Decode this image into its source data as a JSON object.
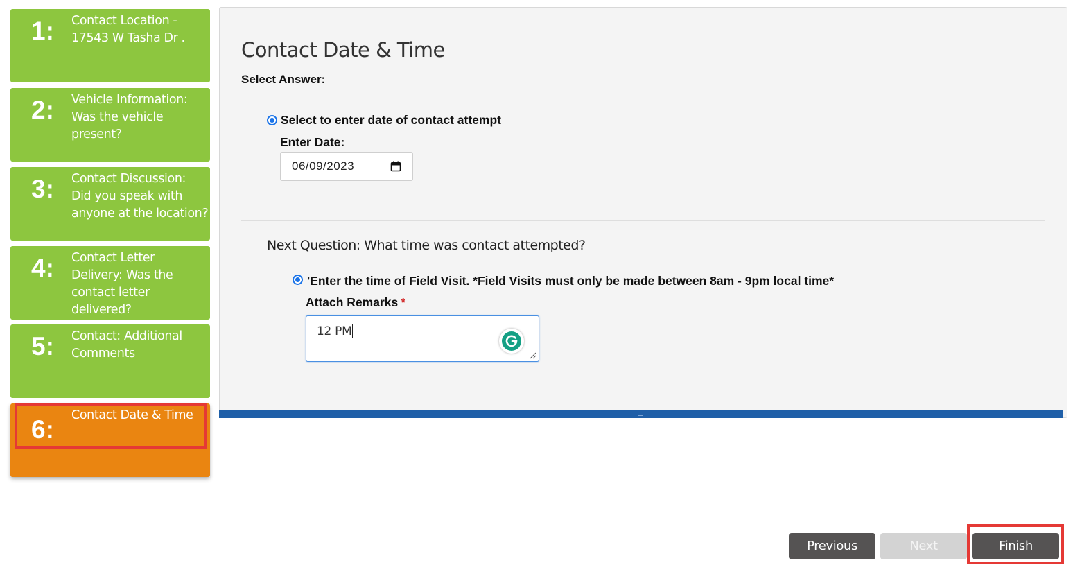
{
  "sidebar": {
    "steps": [
      {
        "number": "1:",
        "label": "Contact Location - 17543 W Tasha Dr ."
      },
      {
        "number": "2:",
        "label": "Vehicle Information: Was the vehicle present?"
      },
      {
        "number": "3:",
        "label": "Contact Discussion: Did you speak with anyone at the location?"
      },
      {
        "number": "4:",
        "label": "Contact Letter Delivery: Was the contact letter delivered?"
      },
      {
        "number": "5:",
        "label": "Contact: Additional Comments"
      },
      {
        "number": "6:",
        "label": "Contact Date & Time"
      }
    ],
    "completed_color": "#8dc63f",
    "active_color": "#ea8511"
  },
  "main": {
    "title": "Contact Date & Time",
    "select_answer_label": "Select Answer:",
    "option1": {
      "label": "Select to enter date of contact attempt",
      "selected": true,
      "enter_date_label": "Enter Date:",
      "date_value": "06/09/2023"
    },
    "next_question": "Next Question: What time was contact attempted?",
    "option2": {
      "label": "'Enter the time of Field Visit. *Field Visits must only be made between 8am - 9pm local time*",
      "selected": true,
      "remarks_label": "Attach Remarks",
      "required_marker": "*",
      "remarks_value": "12 PM"
    },
    "accent_color": "#1f5fa8"
  },
  "buttons": {
    "previous": "Previous",
    "next": "Next",
    "finish": "Finish"
  },
  "icons": {
    "calendar": "calendar-icon",
    "grammarly": "grammarly-icon",
    "resize": "resize-handle-icon"
  }
}
